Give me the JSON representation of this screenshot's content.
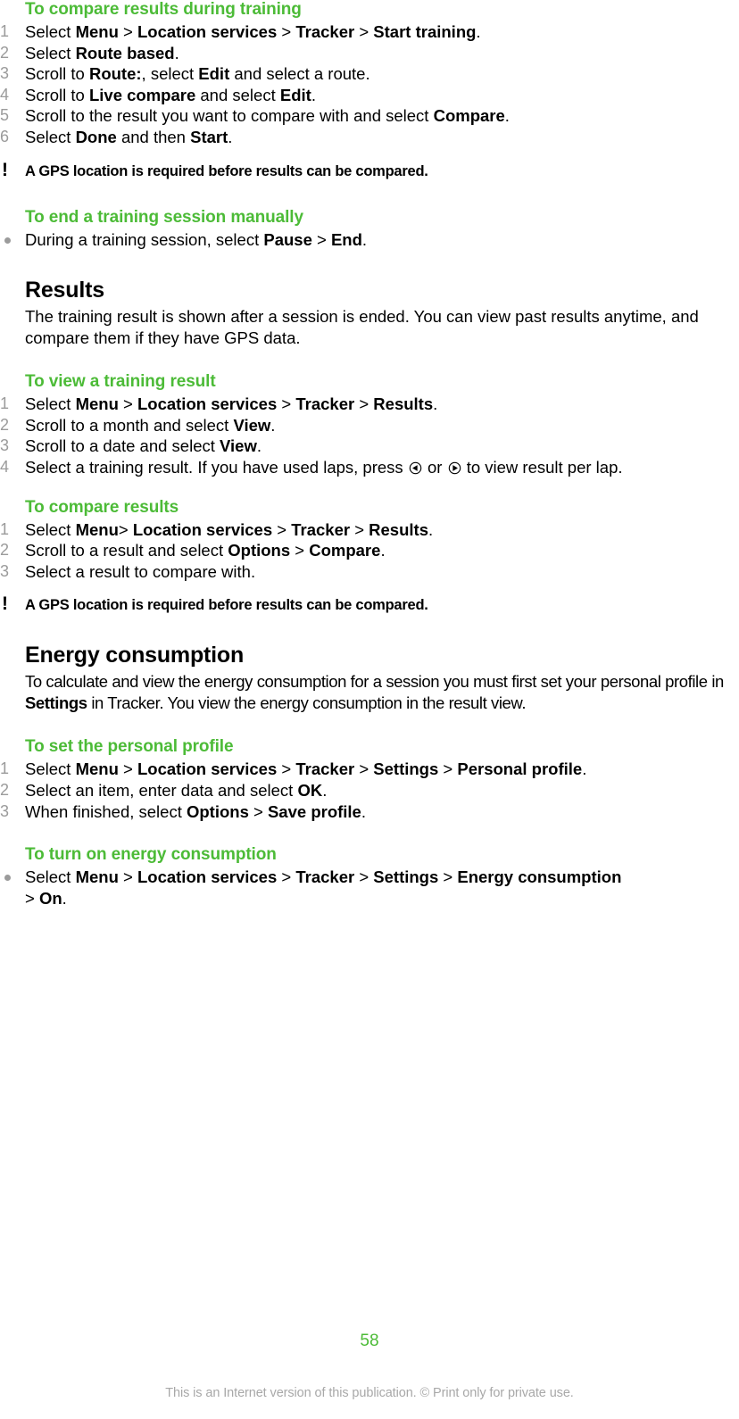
{
  "document": {
    "page_number": "58",
    "footer_note": "This is an Internet version of this publication. © Print only for private use.",
    "accent_color": "#4cbb37",
    "marker_color": "#9b9b9b"
  },
  "sections": [
    {
      "id": "compare-during-training",
      "heading": "To compare results during training",
      "list_type": "ordered",
      "steps": [
        {
          "num": "1",
          "parts": [
            {
              "t": "Select ",
              "b": false
            },
            {
              "t": "Menu",
              "b": true
            },
            {
              "t": " > ",
              "b": false
            },
            {
              "t": "Location services",
              "b": true
            },
            {
              "t": " > ",
              "b": false
            },
            {
              "t": "Tracker",
              "b": true
            },
            {
              "t": " > ",
              "b": false
            },
            {
              "t": "Start training",
              "b": true
            },
            {
              "t": ".",
              "b": false
            }
          ]
        },
        {
          "num": "2",
          "parts": [
            {
              "t": "Select ",
              "b": false
            },
            {
              "t": "Route based",
              "b": true
            },
            {
              "t": ".",
              "b": false
            }
          ]
        },
        {
          "num": "3",
          "parts": [
            {
              "t": "Scroll to ",
              "b": false
            },
            {
              "t": "Route:",
              "b": true
            },
            {
              "t": ", select ",
              "b": false
            },
            {
              "t": "Edit",
              "b": true
            },
            {
              "t": " and select a route.",
              "b": false
            }
          ]
        },
        {
          "num": "4",
          "parts": [
            {
              "t": "Scroll to ",
              "b": false
            },
            {
              "t": "Live compare",
              "b": true
            },
            {
              "t": " and select ",
              "b": false
            },
            {
              "t": "Edit",
              "b": true
            },
            {
              "t": ".",
              "b": false
            }
          ]
        },
        {
          "num": "5",
          "parts": [
            {
              "t": "Scroll to the result you want to compare with and select ",
              "b": false
            },
            {
              "t": "Compare",
              "b": true
            },
            {
              "t": ".",
              "b": false
            }
          ]
        },
        {
          "num": "6",
          "parts": [
            {
              "t": "Select ",
              "b": false
            },
            {
              "t": "Done",
              "b": true
            },
            {
              "t": " and then ",
              "b": false
            },
            {
              "t": "Start",
              "b": true
            },
            {
              "t": ".",
              "b": false
            }
          ]
        }
      ],
      "note": "A GPS location is required before results can be compared."
    },
    {
      "id": "end-training-manually",
      "heading": "To end a training session manually",
      "list_type": "bulleted",
      "steps": [
        {
          "num": "•",
          "parts": [
            {
              "t": "During a training session, select ",
              "b": false
            },
            {
              "t": "Pause",
              "b": true
            },
            {
              "t": " > ",
              "b": false
            },
            {
              "t": "End",
              "b": true
            },
            {
              "t": ".",
              "b": false
            }
          ]
        }
      ]
    }
  ],
  "results_block": {
    "heading": "Results",
    "paragraph": "The training result is shown after a session is ended. You can view past results anytime, and compare them if they have GPS data."
  },
  "view_result": {
    "heading": "To view a training result",
    "steps": [
      {
        "num": "1",
        "parts": [
          {
            "t": "Select ",
            "b": false
          },
          {
            "t": "Menu",
            "b": true
          },
          {
            "t": " > ",
            "b": false
          },
          {
            "t": "Location services",
            "b": true
          },
          {
            "t": " > ",
            "b": false
          },
          {
            "t": "Tracker",
            "b": true
          },
          {
            "t": " > ",
            "b": false
          },
          {
            "t": "Results",
            "b": true
          },
          {
            "t": ".",
            "b": false
          }
        ]
      },
      {
        "num": "2",
        "parts": [
          {
            "t": "Scroll to a month and select ",
            "b": false
          },
          {
            "t": "View",
            "b": true
          },
          {
            "t": ".",
            "b": false
          }
        ]
      },
      {
        "num": "3",
        "parts": [
          {
            "t": "Scroll to a date and select ",
            "b": false
          },
          {
            "t": "View",
            "b": true
          },
          {
            "t": ".",
            "b": false
          }
        ]
      }
    ],
    "step4": {
      "num": "4",
      "before": "Select a training result. If you have used laps, press ",
      "middle": " or ",
      "after": " to view result per lap.",
      "icon_left": "nav-key-left-icon",
      "icon_right": "nav-key-right-icon"
    }
  },
  "compare_results": {
    "heading": "To compare results",
    "steps": [
      {
        "num": "1",
        "parts": [
          {
            "t": "Select ",
            "b": false
          },
          {
            "t": "Menu",
            "b": true
          },
          {
            "t": "> ",
            "b": false
          },
          {
            "t": "Location services",
            "b": true
          },
          {
            "t": " > ",
            "b": false
          },
          {
            "t": "Tracker",
            "b": true
          },
          {
            "t": " > ",
            "b": false
          },
          {
            "t": "Results",
            "b": true
          },
          {
            "t": ".",
            "b": false
          }
        ]
      },
      {
        "num": "2",
        "parts": [
          {
            "t": "Scroll to a result and select ",
            "b": false
          },
          {
            "t": "Options",
            "b": true
          },
          {
            "t": " > ",
            "b": false
          },
          {
            "t": "Compare",
            "b": true
          },
          {
            "t": ".",
            "b": false
          }
        ]
      },
      {
        "num": "3",
        "parts": [
          {
            "t": "Select a result to compare with.",
            "b": false
          }
        ]
      }
    ],
    "note": "A GPS location is required before results can be compared."
  },
  "energy_block": {
    "heading": "Energy consumption",
    "paragraph_parts": [
      {
        "t": "To calculate and view the energy consumption for a session you must first set your personal profile in ",
        "b": false
      },
      {
        "t": "Settings",
        "b": true
      },
      {
        "t": " in Tracker. You view the energy consumption in the result view.",
        "b": false
      }
    ]
  },
  "personal_profile": {
    "heading": "To set the personal profile",
    "steps": [
      {
        "num": "1",
        "parts": [
          {
            "t": "Select ",
            "b": false
          },
          {
            "t": "Menu",
            "b": true
          },
          {
            "t": " > ",
            "b": false
          },
          {
            "t": "Location services",
            "b": true
          },
          {
            "t": " > ",
            "b": false
          },
          {
            "t": "Tracker",
            "b": true
          },
          {
            "t": " > ",
            "b": false
          },
          {
            "t": "Settings",
            "b": true
          },
          {
            "t": " > ",
            "b": false
          },
          {
            "t": "Personal profile",
            "b": true
          },
          {
            "t": ".",
            "b": false
          }
        ]
      },
      {
        "num": "2",
        "parts": [
          {
            "t": "Select an item, enter data and select ",
            "b": false
          },
          {
            "t": "OK",
            "b": true
          },
          {
            "t": ".",
            "b": false
          }
        ]
      },
      {
        "num": "3",
        "parts": [
          {
            "t": "When finished, select ",
            "b": false
          },
          {
            "t": "Options",
            "b": true
          },
          {
            "t": " > ",
            "b": false
          },
          {
            "t": "Save profile",
            "b": true
          },
          {
            "t": ".",
            "b": false
          }
        ]
      }
    ]
  },
  "turn_on_energy": {
    "heading": "To turn on energy consumption",
    "steps": [
      {
        "num": "•",
        "parts": [
          {
            "t": "Select ",
            "b": false
          },
          {
            "t": "Menu",
            "b": true
          },
          {
            "t": " > ",
            "b": false
          },
          {
            "t": "Location services",
            "b": true
          },
          {
            "t": " > ",
            "b": false
          },
          {
            "t": "Tracker",
            "b": true
          },
          {
            "t": " > ",
            "b": false
          },
          {
            "t": "Settings",
            "b": true
          },
          {
            "t": " > ",
            "b": false
          },
          {
            "t": "Energy consumption",
            "b": true
          },
          {
            "t": "\n> ",
            "b": false
          },
          {
            "t": "On",
            "b": true
          },
          {
            "t": ".",
            "b": false
          }
        ]
      }
    ]
  }
}
